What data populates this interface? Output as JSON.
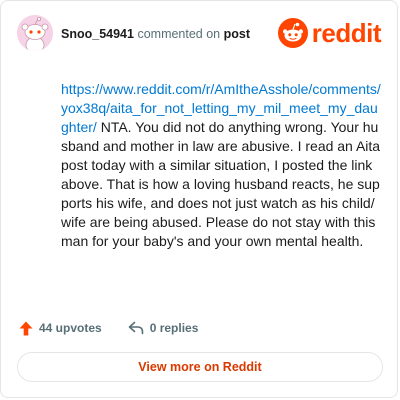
{
  "comment": {
    "username": "Snoo_54941",
    "action_text": "commented on",
    "post_link_text": "post",
    "link_text": "https://www.reddit.com/r/AmItheAsshole/comments/yox38q/aita_for_not_letting_my_mil_meet_my_daughter/",
    "body_text": " NTA. You did not do anything wrong. Your husband and mother in law are abusive. I read an Aita post today with a similar situation, I posted the link above. That is how a loving husband reacts, he supports his wife, and does not just watch as his child/wife are being abused. Please do not stay with this man for your baby's and your own mental health."
  },
  "brand": {
    "name": "reddit",
    "accent_color": "#ff4500"
  },
  "stats": {
    "upvotes_label": "44 upvotes",
    "replies_label": "0 replies"
  },
  "footer": {
    "view_more_label": "View more on Reddit"
  },
  "icons": {
    "avatar": "snoo-avatar",
    "logo": "reddit-snoo-icon",
    "upvote": "upvote-arrow-icon",
    "reply": "reply-arrow-icon"
  }
}
